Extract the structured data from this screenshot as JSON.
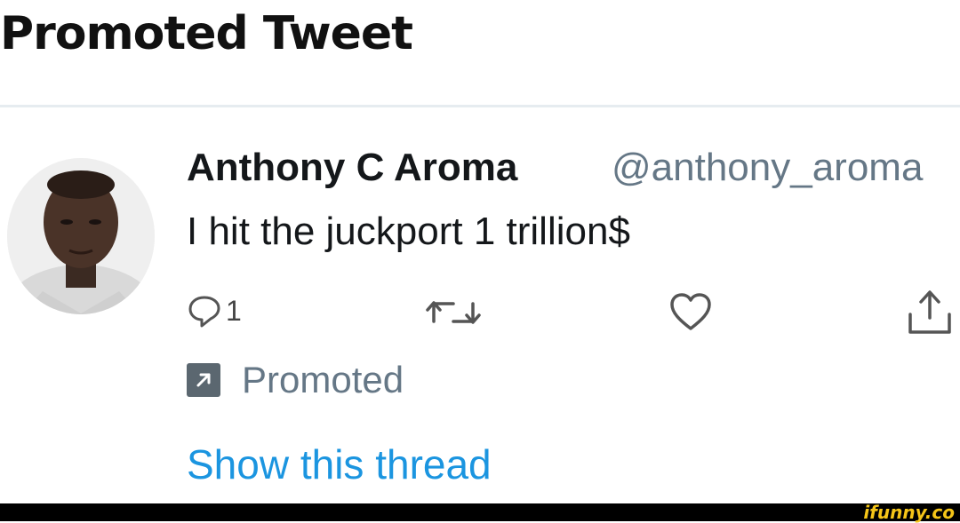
{
  "header": {
    "title": "Promoted Tweet"
  },
  "tweet": {
    "author_name": "Anthony C Aroma",
    "author_handle": "@anthony_aroma",
    "text": "I hit the juckport 1 trillion$",
    "actions": {
      "reply_count": "1"
    },
    "promoted_label": "Promoted",
    "show_thread_label": "Show this thread"
  },
  "watermark": "ifunny.co",
  "colors": {
    "link": "#1b95e0",
    "secondary_text": "#657786",
    "divider": "#e6ecf0"
  },
  "icons": [
    "reply-icon",
    "retweet-icon",
    "like-icon",
    "share-icon",
    "promoted-icon"
  ]
}
